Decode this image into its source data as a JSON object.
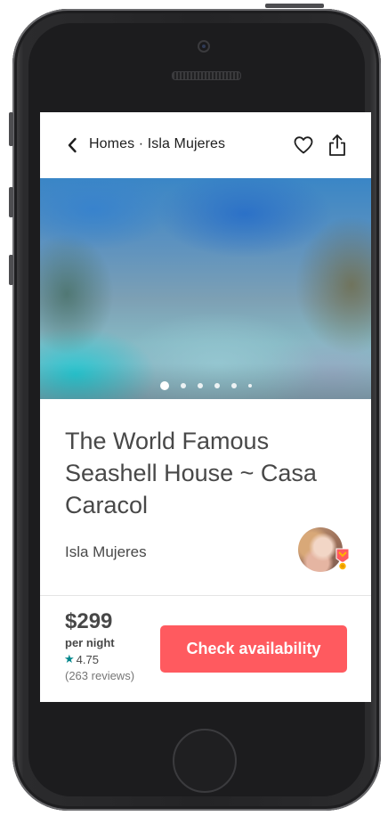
{
  "navbar": {
    "breadcrumb": "Homes · Isla Mujeres",
    "back_icon": "chevron-left-icon",
    "favorite_icon": "heart-outline-icon",
    "share_icon": "share-icon"
  },
  "photo": {
    "carousel_dots": 6,
    "active_index": 0
  },
  "listing": {
    "title": "The World Famous Seashell House ~ Casa Caracol",
    "location": "Isla Mujeres",
    "host_badge": "superhost-badge-icon"
  },
  "booking": {
    "price": "$299",
    "per_night": "per night",
    "rating": "4.75",
    "reviews": "(263 reviews)",
    "cta_label": "Check availability"
  },
  "colors": {
    "accent": "#FF5A5F",
    "star": "#00868B",
    "text": "#484848",
    "muted": "#767676"
  }
}
